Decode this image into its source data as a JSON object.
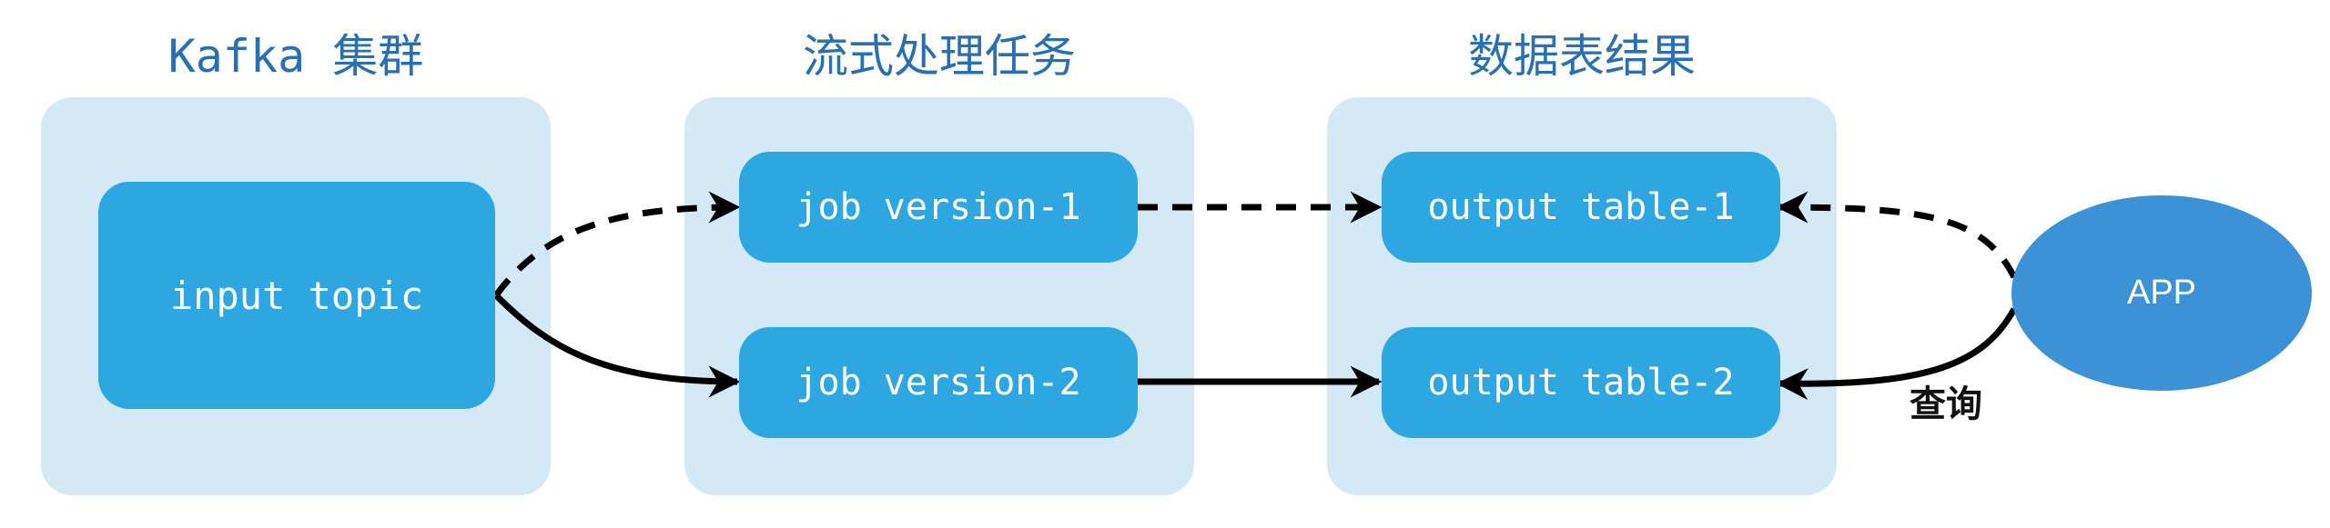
{
  "groups": [
    {
      "title": "Kafka 集群"
    },
    {
      "title": "流式处理任务"
    },
    {
      "title": "数据表结果"
    }
  ],
  "nodes": {
    "input_topic": "input topic",
    "job_v1": "job version-1",
    "job_v2": "job version-2",
    "output_t1": "output table-1",
    "output_t2": "output table-2",
    "app": "APP"
  },
  "edge_labels": {
    "query": "查询"
  },
  "colors": {
    "panel": "#d3eaf6",
    "node": "#2ea7e0",
    "app": "#3d92d5",
    "title": "#2a6fb0",
    "edge": "#000000"
  },
  "edges": [
    {
      "from": "input topic",
      "to": "job version-1",
      "style": "dashed"
    },
    {
      "from": "input topic",
      "to": "job version-2",
      "style": "solid"
    },
    {
      "from": "job version-1",
      "to": "output table-1",
      "style": "dashed"
    },
    {
      "from": "job version-2",
      "to": "output table-2",
      "style": "solid"
    },
    {
      "from": "APP",
      "to": "output table-1",
      "style": "dashed"
    },
    {
      "from": "APP",
      "to": "output table-2",
      "style": "solid"
    }
  ]
}
